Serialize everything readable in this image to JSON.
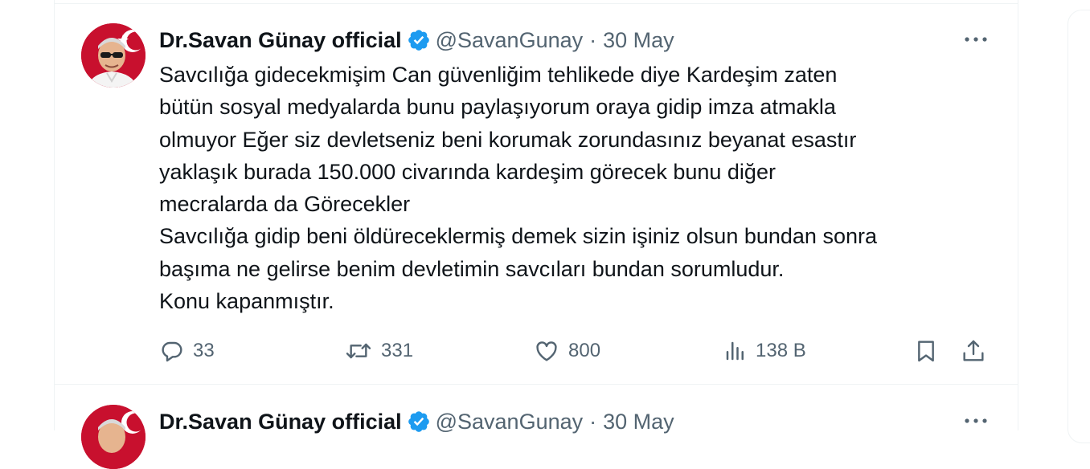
{
  "tweets": [
    {
      "author": {
        "display_name": "Dr.Savan Günay official",
        "verified_icon": "verified-badge-icon",
        "handle": "@SavanGunay",
        "separator": "·",
        "date": "30 May"
      },
      "text_lines": [
        "Savcılığa gidecekmişim Can güvenliğim tehlikede diye Kardeşim zaten",
        "bütün sosyal medyalarda bunu paylaşıyorum oraya gidip imza atmakla",
        "olmuyor Eğer siz devletseniz beni korumak zorundasınız beyanat esastır",
        "yaklaşık burada 150.000 civarında kardeşim görecek bunu diğer",
        "mecralarda da Görecekler",
        "Savcılığa gidip beni öldüreceklermiş demek sizin işiniz olsun bundan sonra",
        "başıma ne gelirse benim devletimin savcıları bundan sorumludur.",
        "Konu kapanmıştır."
      ],
      "actions": {
        "replies": "33",
        "reposts": "331",
        "likes": "800",
        "views": "138 B"
      }
    },
    {
      "author": {
        "display_name": "Dr.Savan Günay official",
        "verified_icon": "verified-badge-icon",
        "handle": "@SavanGunay",
        "separator": "·",
        "date": "30 May"
      }
    }
  ],
  "colors": {
    "text_primary": "#0f1419",
    "text_secondary": "#536471",
    "verified_blue": "#1d9bf0",
    "border": "#eff3f4",
    "avatar_red": "#c8102e"
  }
}
